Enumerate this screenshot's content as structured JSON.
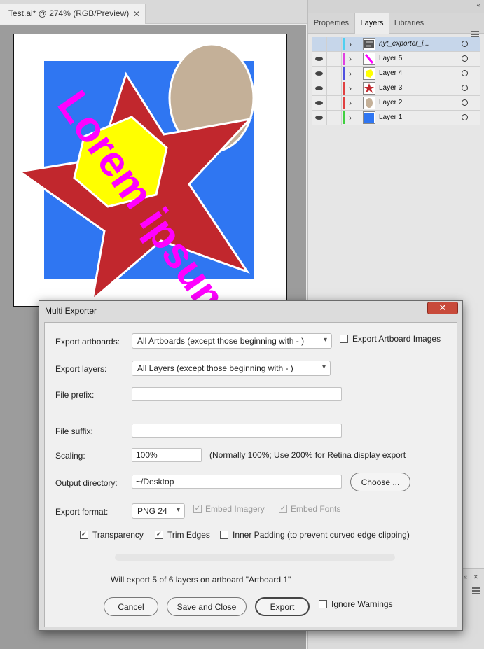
{
  "document": {
    "tab_title": "Test.ai* @ 274% (RGB/Preview)",
    "close_glyph": "✕"
  },
  "panel": {
    "tabs": [
      "Properties",
      "Layers",
      "Libraries"
    ],
    "active_tab": "Layers",
    "collapse_glyph": "«",
    "layers": [
      {
        "name": "nyt_exporter_i...",
        "color": "#4fd0f0",
        "visible": false,
        "selected": true,
        "thumb": "settings-image"
      },
      {
        "name": "Layer 5",
        "color": "#e040e0",
        "visible": true,
        "selected": false,
        "thumb": "text-magenta"
      },
      {
        "name": "Layer 4",
        "color": "#5050e0",
        "visible": true,
        "selected": false,
        "thumb": "yellow-shape"
      },
      {
        "name": "Layer 3",
        "color": "#e04040",
        "visible": true,
        "selected": false,
        "thumb": "red-star"
      },
      {
        "name": "Layer 2",
        "color": "#e04040",
        "visible": true,
        "selected": false,
        "thumb": "tan-ellipse"
      },
      {
        "name": "Layer 1",
        "color": "#40d040",
        "visible": true,
        "selected": false,
        "thumb": "blue-square"
      }
    ],
    "lower_controls": "« ✕"
  },
  "artwork": {
    "text": "Lorem ipsum",
    "colors": {
      "blue": "#2f76f2",
      "tan": "#c4b098",
      "red": "#c1272d",
      "yellow": "#ffff00",
      "magenta": "#ff00ff"
    }
  },
  "dialog": {
    "title": "Multi Exporter",
    "close_glyph": "✕",
    "export_artboards_label": "Export artboards:",
    "export_artboards_value": "All Artboards (except those beginning with - )",
    "export_artboard_images_label": "Export Artboard Images",
    "export_artboard_images_checked": false,
    "export_layers_label": "Export layers:",
    "export_layers_value": "All Layers (except those beginning with - )",
    "file_prefix_label": "File prefix:",
    "file_prefix_value": "",
    "file_suffix_label": "File suffix:",
    "file_suffix_value": "",
    "scaling_label": "Scaling:",
    "scaling_value": "100%",
    "scaling_note": "(Normally 100%; Use 200% for Retina display export",
    "output_dir_label": "Output directory:",
    "output_dir_value": "~/Desktop",
    "choose_label": "Choose ...",
    "export_format_label": "Export format:",
    "export_format_value": "PNG 24",
    "embed_imagery_label": "Embed Imagery",
    "embed_fonts_label": "Embed Fonts",
    "transparency_label": "Transparency",
    "transparency_checked": true,
    "trim_edges_label": "Trim Edges",
    "trim_edges_checked": true,
    "inner_padding_label": "Inner Padding (to prevent curved edge clipping)",
    "inner_padding_checked": false,
    "progress_fraction": 0,
    "status_text": "Will export 5 of 6 layers on artboard \"Artboard 1\"",
    "cancel_label": "Cancel",
    "save_close_label": "Save and Close",
    "export_label": "Export",
    "ignore_warnings_label": "Ignore Warnings",
    "ignore_warnings_checked": false,
    "check_glyph": "✓",
    "caret_glyph": "▾"
  }
}
